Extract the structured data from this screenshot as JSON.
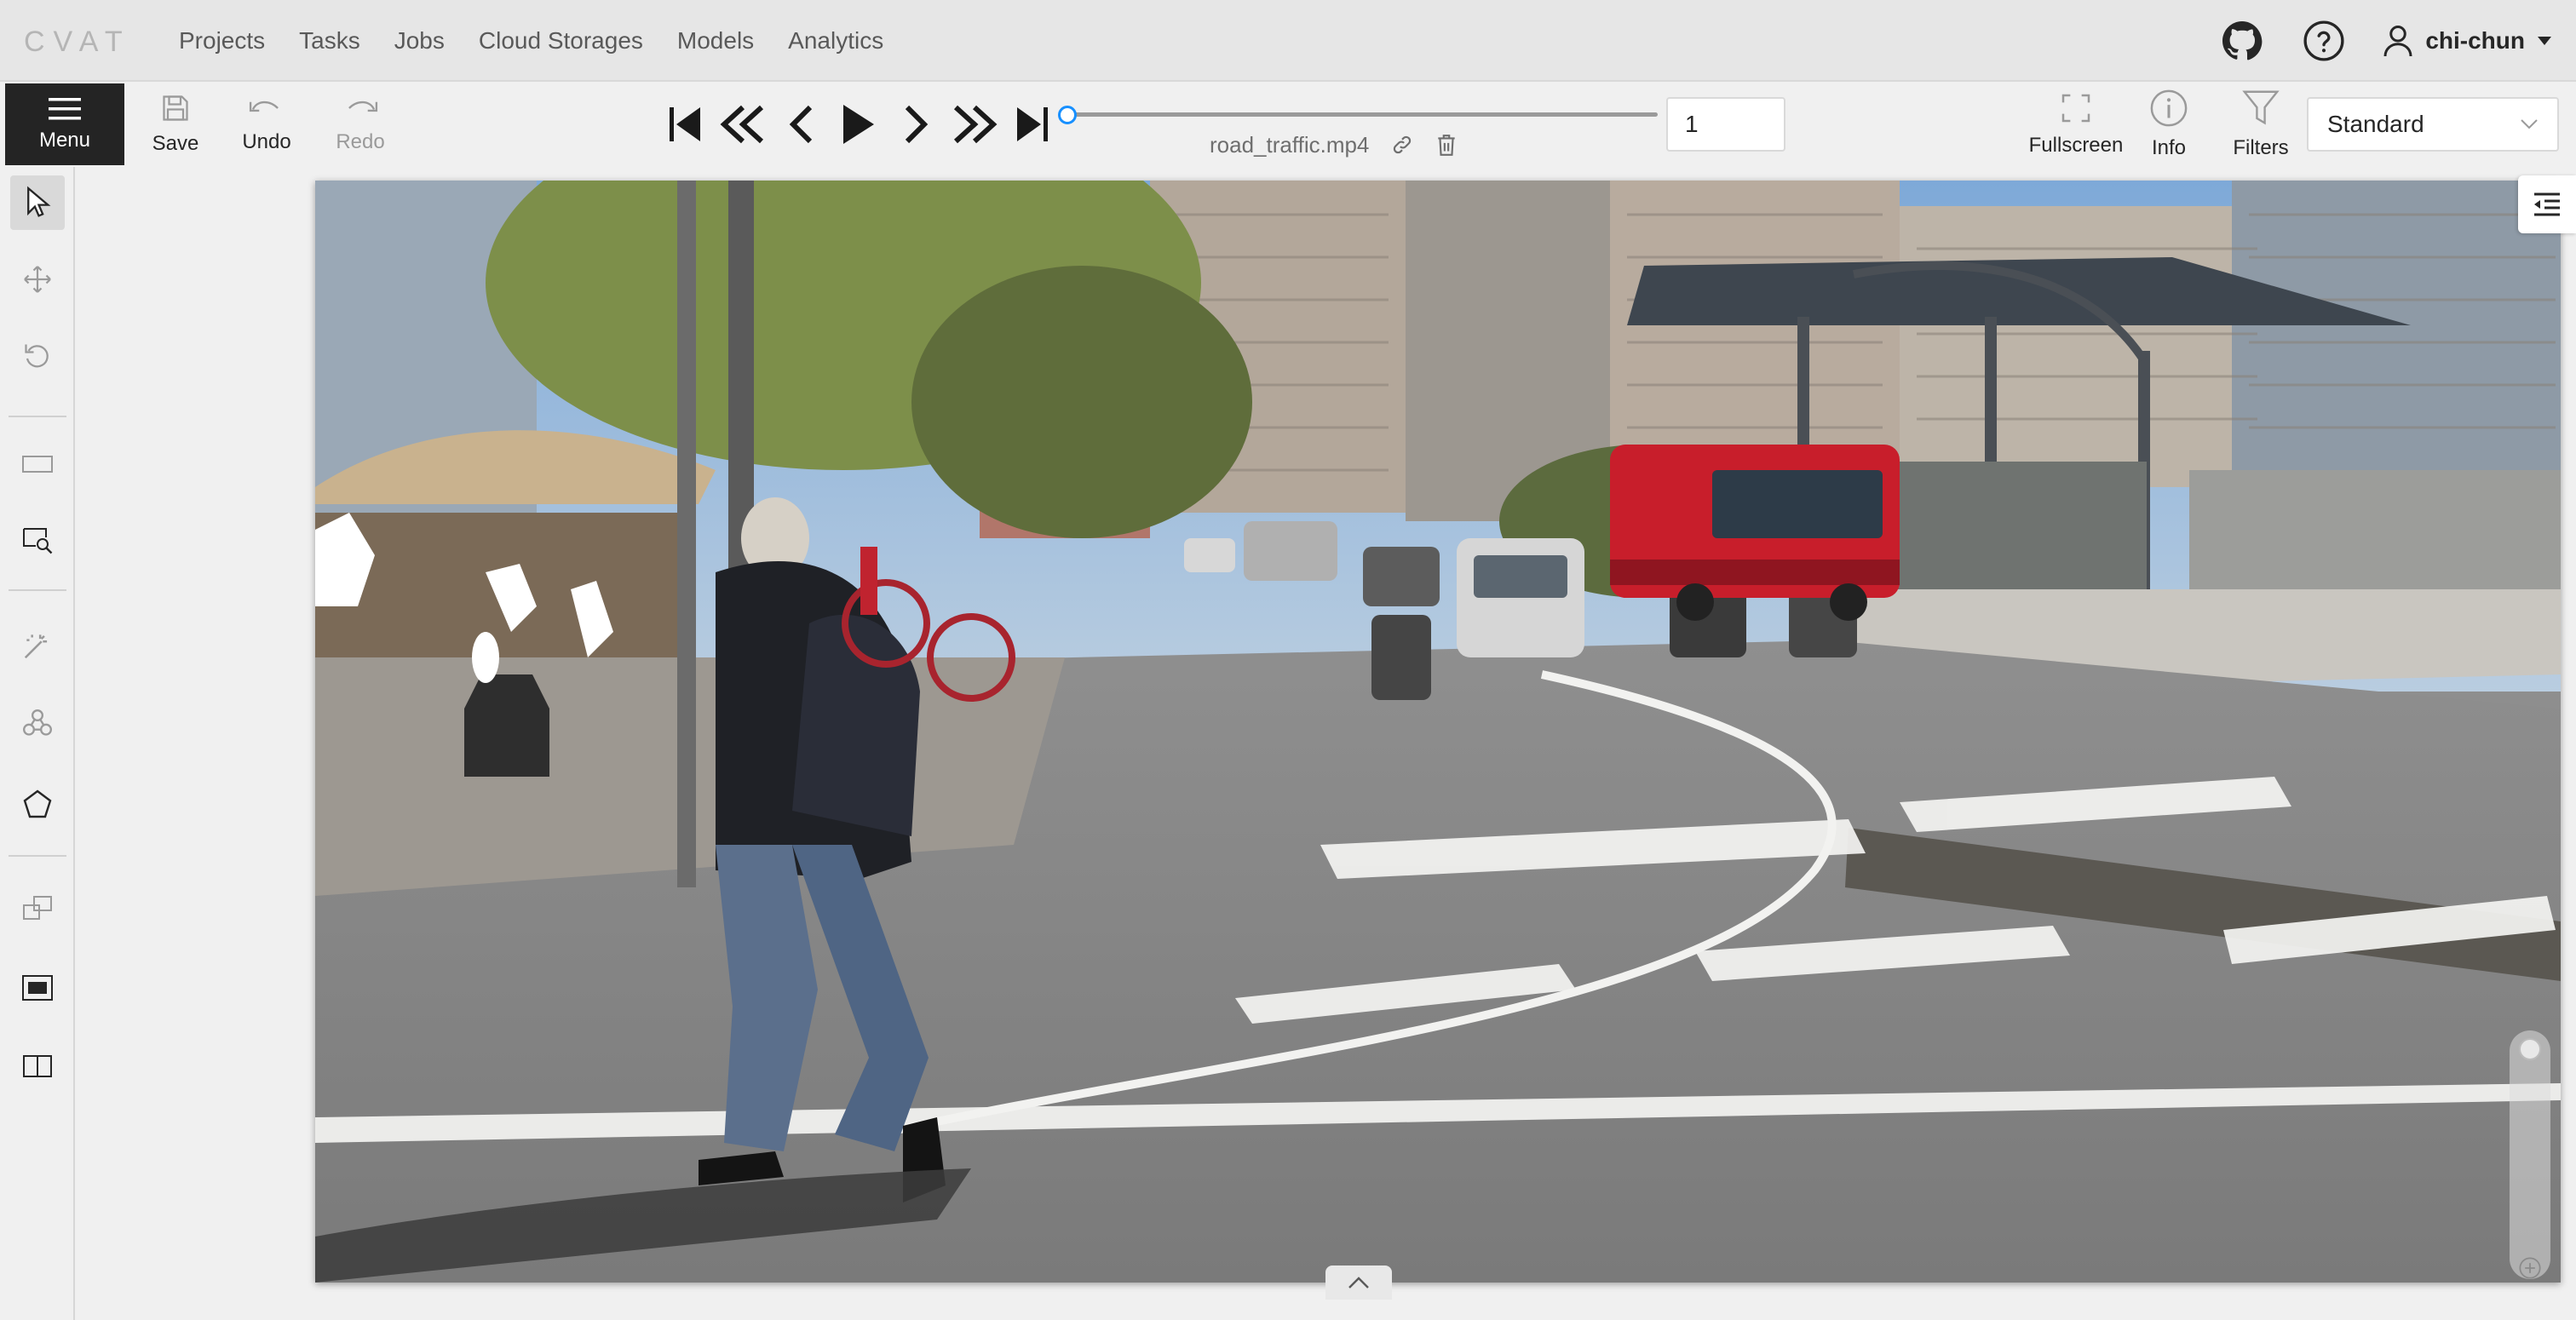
{
  "app": {
    "logo_text": "CVAT",
    "nav": [
      "Projects",
      "Tasks",
      "Jobs",
      "Cloud Storages",
      "Models",
      "Analytics"
    ],
    "user": "chi-chun"
  },
  "toolbar": {
    "menu_label": "Menu",
    "save_label": "Save",
    "undo_label": "Undo",
    "redo_label": "Redo",
    "filename": "road_traffic.mp4",
    "frame_number": "1",
    "fullscreen_label": "Fullscreen",
    "info_label": "Info",
    "filters_label": "Filters",
    "workspace": "Standard",
    "playback_progress": 0
  },
  "icons": {
    "github": "github-icon",
    "help": "question-circle-icon",
    "user": "user-icon",
    "menu": "hamburger-icon",
    "save": "save-icon",
    "undo": "undo-icon",
    "redo": "redo-icon",
    "first": "step-backward-icon",
    "back_fast": "fast-backward-icon",
    "prev": "previous-icon",
    "play": "play-icon",
    "next": "next-icon",
    "forward_fast": "fast-forward-icon",
    "last": "step-forward-icon",
    "link": "link-icon",
    "delete": "delete-icon",
    "fullscreen": "fullscreen-icon",
    "info": "info-icon",
    "filter": "filter-icon"
  },
  "colors": {
    "accent": "#1890ff",
    "menu_bg": "#242424",
    "bus_red": "#c81e2b"
  }
}
